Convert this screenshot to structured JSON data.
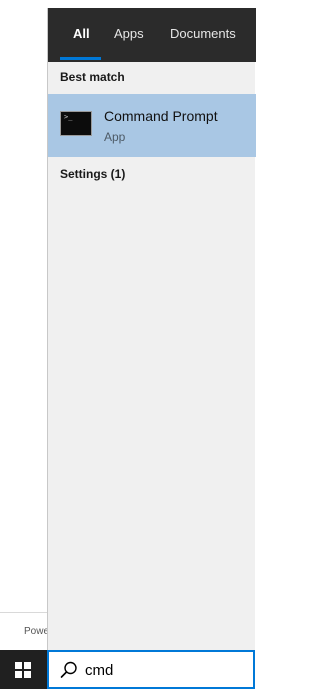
{
  "background_window": {
    "footer_text": "Powe"
  },
  "tabs": [
    {
      "label": "All",
      "selected": true
    },
    {
      "label": "Apps",
      "selected": false
    },
    {
      "label": "Documents",
      "selected": false
    }
  ],
  "best_match": {
    "header": "Best match",
    "result": {
      "title": "Command Prompt",
      "subtitle": "App",
      "icon": "command-prompt-icon"
    }
  },
  "settings": {
    "label": "Settings (1)"
  },
  "taskbar": {
    "start_icon": "windows-logo-icon",
    "search": {
      "icon": "search-icon",
      "value": "cmd"
    }
  },
  "colors": {
    "accent": "#0078d7",
    "tabbar_bg": "#2b2b2b",
    "panel_bg": "#f0f0f0",
    "selected_result_bg": "#a9c7e4",
    "taskbar_bg": "#202020"
  }
}
